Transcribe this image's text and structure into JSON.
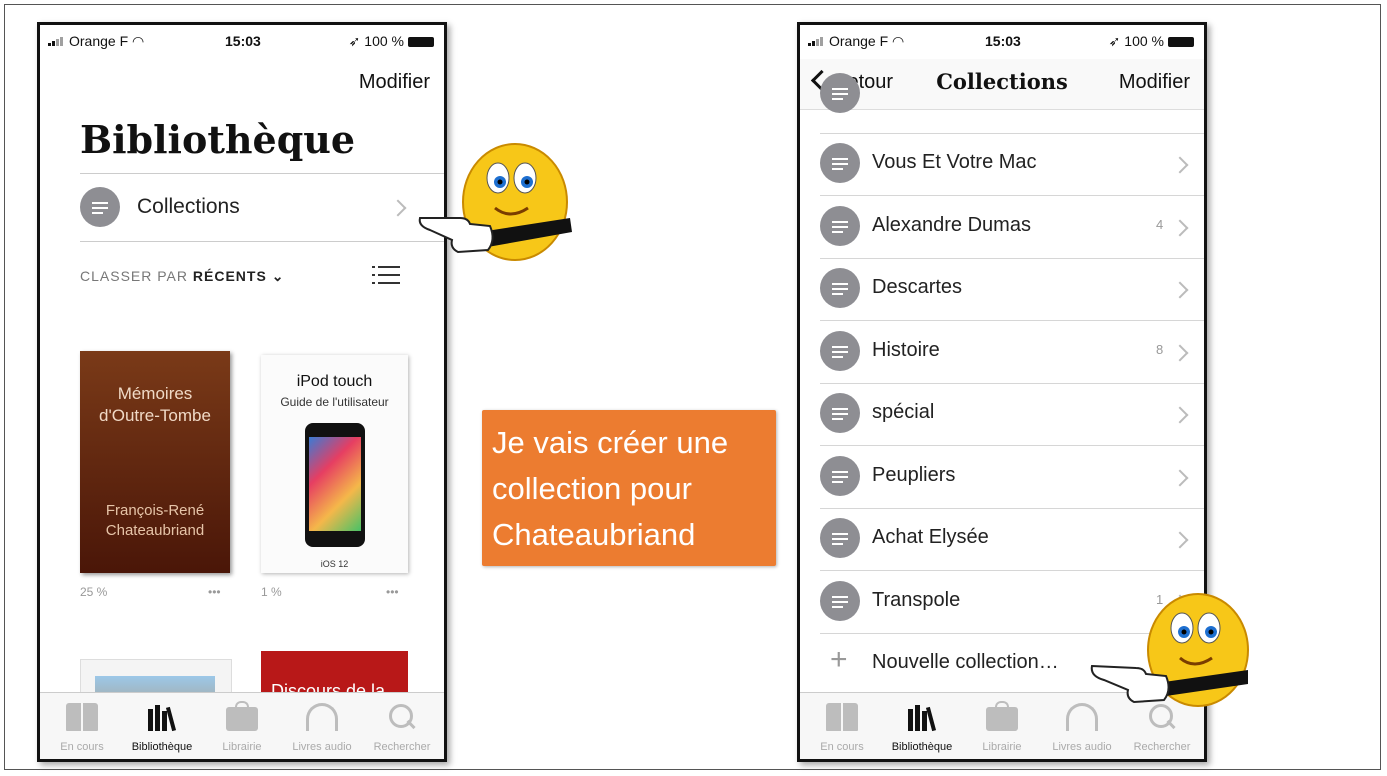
{
  "left_phone": {
    "status": {
      "carrier": "Orange F",
      "time": "15:03",
      "battery": "100 %"
    },
    "modifier_label": "Modifier",
    "title": "Bibliothèque",
    "collections_label": "Collections",
    "sort": {
      "prefix": "CLASSER PAR",
      "value": "RÉCENTS",
      "caret": "⌄"
    },
    "books": [
      {
        "title": "Mémoires d'Outre-Tombe",
        "author": "François-René Chateaubriand",
        "progress": "25 %",
        "more": "•••"
      },
      {
        "title": "iPod touch",
        "subtitle": "Guide de l'utilisateur",
        "footer": "iOS 12",
        "progress": "1 %",
        "more": "•••"
      },
      {
        "title_partial": "Discours de la"
      }
    ],
    "tabs": [
      "En cours",
      "Bibliothèque",
      "Librairie",
      "Livres audio",
      "Rechercher"
    ]
  },
  "right_phone": {
    "status": {
      "carrier": "Orange F",
      "time": "15:03",
      "battery": "100 %"
    },
    "nav": {
      "back_label": "Retour",
      "title": "Collections",
      "modifier_label": "Modifier"
    },
    "collections": [
      {
        "name": "Vous Et Votre Mac",
        "count": ""
      },
      {
        "name": "Alexandre Dumas",
        "count": "4"
      },
      {
        "name": "Descartes",
        "count": ""
      },
      {
        "name": "Histoire",
        "count": "8"
      },
      {
        "name": "spécial",
        "count": ""
      },
      {
        "name": "Peupliers",
        "count": ""
      },
      {
        "name": "Achat Elysée",
        "count": ""
      },
      {
        "name": "Transpole",
        "count": "1"
      }
    ],
    "new_collection_label": "Nouvelle collection…",
    "tabs": [
      "En cours",
      "Bibliothèque",
      "Librairie",
      "Livres audio",
      "Rechercher"
    ]
  },
  "callout": {
    "lines": [
      "Je vais créer une",
      "collection pour",
      "Chateaubriand"
    ],
    "color": "#ec7c30"
  },
  "colors": {
    "icon_gray": "#8e8e93",
    "accent_orange": "#ec7c30"
  }
}
